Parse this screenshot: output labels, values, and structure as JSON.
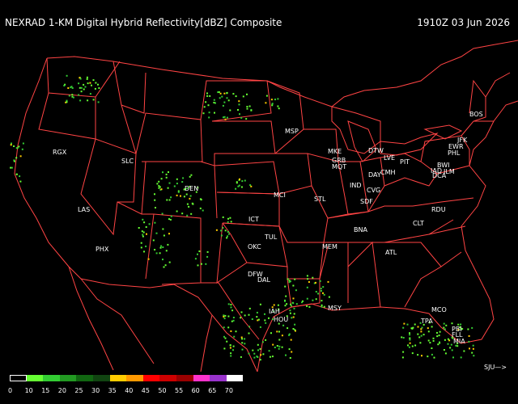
{
  "header": {
    "title": "NEXRAD 1-KM Digital Hybrid Reflectivity[dBZ] Composite",
    "timestamp": "1910Z 03 Jun 2026"
  },
  "nav": {
    "label": "SJU—>"
  },
  "stations": [
    "RGX",
    "SLC",
    "LAS",
    "PHX",
    "DEN",
    "MSP",
    "MKE",
    "GRB",
    "MQT",
    "DTW",
    "LVE",
    "PIT",
    "DAY",
    "CMH",
    "CVG",
    "IND",
    "SDF",
    "STL",
    "MCI",
    "ICT",
    "TUL",
    "OKC",
    "DFW",
    "DAL",
    "BNA",
    "MEM",
    "ATL",
    "CLT",
    "RDU",
    "IAH",
    "HOU",
    "MSY",
    "MCO",
    "TPA",
    "PBI",
    "FLL",
    "MIA",
    "BOS",
    "JFK",
    "EWR",
    "PHL",
    "BWI",
    "IAD",
    "DCA",
    "ILM"
  ],
  "legend": {
    "ticks": [
      "0",
      "10",
      "15",
      "20",
      "25",
      "30",
      "35",
      "40",
      "45",
      "50",
      "55",
      "60",
      "65",
      "70"
    ],
    "colors": [
      "#000000",
      "#66ff33",
      "#33cc33",
      "#229922",
      "#116611",
      "#114411",
      "#ffcc00",
      "#ff9900",
      "#ff0000",
      "#cc0000",
      "#990000",
      "#ff33cc",
      "#9933cc",
      "#ffffff"
    ]
  },
  "colors": {
    "borders": "#ff4444",
    "background": "#000000",
    "echo": "#33cc33",
    "strong_echo": "#ffcc00"
  }
}
